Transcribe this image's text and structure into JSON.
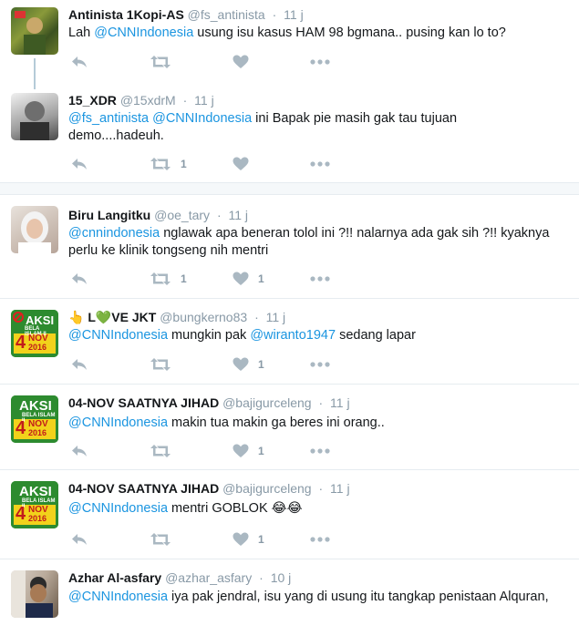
{
  "tweets": [
    {
      "name": "Antinista 1Kopi-AS",
      "handle": "@fs_antinista",
      "sep": "·",
      "time": "11 j",
      "text": {
        "pre": "Lah ",
        "m1": "@CNNIndonesia",
        "post": " usung isu kasus HAM 98 bgmana.. pusing kan lo to?"
      },
      "retweets": "",
      "likes": ""
    },
    {
      "name": "15_XDR",
      "handle": "@15xdrM",
      "sep": "·",
      "time": "11 j",
      "text": {
        "m1": "@fs_antinista",
        "mid": " ",
        "m2": "@CNNIndonesia",
        "post": " ini Bapak pie masih gak tau tujuan demo....hadeuh."
      },
      "retweets": "1",
      "likes": ""
    },
    {
      "name": "Biru Langitku",
      "handle": "@oe_tary",
      "sep": "·",
      "time": "11 j",
      "text": {
        "m1": "@cnnindonesia",
        "post": " nglawak apa beneran tolol ini ?!! nalarnya ada gak sih ?!! kyaknya perlu ke klinik tongseng nih mentri"
      },
      "retweets": "1",
      "likes": "1"
    },
    {
      "name": "👆 L💚VE JKT",
      "handle": "@bungkerno83",
      "sep": "·",
      "time": "11 j",
      "text": {
        "m1": "@CNNIndonesia",
        "mid": " mungkin pak ",
        "m2": "@wiranto1947",
        "post": " sedang lapar"
      },
      "retweets": "",
      "likes": "1"
    },
    {
      "name": "04-NOV SAATNYA JIHAD",
      "handle": "@bajigurceleng",
      "sep": "·",
      "time": "11 j",
      "text": {
        "m1": "@CNNIndonesia",
        "post": " makin tua makin ga beres ini orang.."
      },
      "retweets": "",
      "likes": "1"
    },
    {
      "name": "04-NOV SAATNYA JIHAD",
      "handle": "@bajigurceleng",
      "sep": "·",
      "time": "11 j",
      "text": {
        "m1": "@CNNIndonesia",
        "post": " mentri GOBLOK 😂😂"
      },
      "retweets": "",
      "likes": "1"
    },
    {
      "name": "Azhar Al-asfary",
      "handle": "@azhar_asfary",
      "sep": "·",
      "time": "10 j",
      "text": {
        "m1": "@CNNIndonesia",
        "post": " iya pak jendral, isu yang di usung itu tangkap penistaan Alquran,"
      },
      "retweets": "",
      "likes": ""
    }
  ],
  "avatar_badge": {
    "line1": "AKSI",
    "line2": "BELA ISLAM II",
    "line3": "4",
    "line4": "NOV",
    "line5": "2016"
  },
  "icons": [
    "reply-icon",
    "retweet-icon",
    "heart-icon",
    "more-icon"
  ],
  "colors": {
    "mention": "#1b95e0",
    "muted": "#8899a6",
    "badge_green": "#2d8b2f"
  }
}
